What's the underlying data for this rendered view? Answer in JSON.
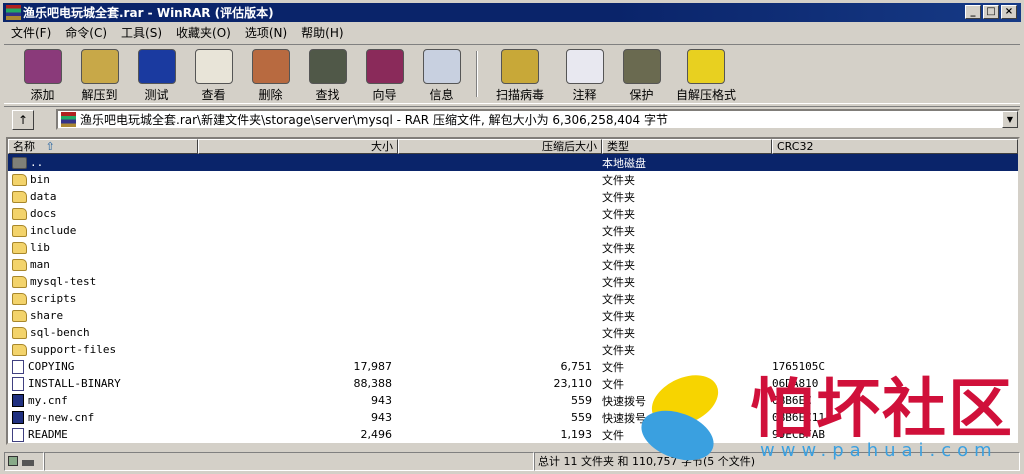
{
  "window": {
    "title": "渔乐吧电玩城全套.rar - WinRAR (评估版本)",
    "minimize": "_",
    "maximize": "□",
    "close": "×"
  },
  "menu": [
    "文件(F)",
    "命令(C)",
    "工具(S)",
    "收藏夹(O)",
    "选项(N)",
    "帮助(H)"
  ],
  "toolbar": [
    {
      "label": "添加",
      "icon": "add-archive-icon",
      "color": "#8a3a7a"
    },
    {
      "label": "解压到",
      "icon": "extract-to-icon",
      "color": "#c8a848"
    },
    {
      "label": "测试",
      "icon": "test-icon",
      "color": "#1a3aa0"
    },
    {
      "label": "查看",
      "icon": "view-icon",
      "color": "#e8e4d8"
    },
    {
      "label": "删除",
      "icon": "delete-icon",
      "color": "#b86a40"
    },
    {
      "label": "查找",
      "icon": "find-icon",
      "color": "#505848"
    },
    {
      "label": "向导",
      "icon": "wizard-icon",
      "color": "#8a2a5a"
    },
    {
      "label": "信息",
      "icon": "info-icon",
      "color": "#c8d0e0"
    },
    {
      "label": "扫描病毒",
      "icon": "scan-virus-icon",
      "color": "#c8a838"
    },
    {
      "label": "注释",
      "icon": "comment-icon",
      "color": "#e8e8f0"
    },
    {
      "label": "保护",
      "icon": "protect-icon",
      "color": "#6a6a50"
    },
    {
      "label": "自解压格式",
      "icon": "sfx-icon",
      "color": "#e8d020"
    }
  ],
  "address": {
    "up": "↑",
    "path": "渔乐吧电玩城全套.rar\\新建文件夹\\storage\\server\\mysql - RAR 压缩文件, 解包大小为 6,306,258,404 字节",
    "dropdown": "▼"
  },
  "columns": {
    "name": "名称",
    "sort": "⇧",
    "size": "大小",
    "packed": "压缩后大小",
    "type": "类型",
    "crc": "CRC32"
  },
  "rows": [
    {
      "name": "..",
      "size": "",
      "packed": "",
      "type": "本地磁盘",
      "crc": "",
      "kind": "up"
    },
    {
      "name": "bin",
      "size": "",
      "packed": "",
      "type": "文件夹",
      "crc": "",
      "kind": "folder"
    },
    {
      "name": "data",
      "size": "",
      "packed": "",
      "type": "文件夹",
      "crc": "",
      "kind": "folder"
    },
    {
      "name": "docs",
      "size": "",
      "packed": "",
      "type": "文件夹",
      "crc": "",
      "kind": "folder"
    },
    {
      "name": "include",
      "size": "",
      "packed": "",
      "type": "文件夹",
      "crc": "",
      "kind": "folder"
    },
    {
      "name": "lib",
      "size": "",
      "packed": "",
      "type": "文件夹",
      "crc": "",
      "kind": "folder"
    },
    {
      "name": "man",
      "size": "",
      "packed": "",
      "type": "文件夹",
      "crc": "",
      "kind": "folder"
    },
    {
      "name": "mysql-test",
      "size": "",
      "packed": "",
      "type": "文件夹",
      "crc": "",
      "kind": "folder"
    },
    {
      "name": "scripts",
      "size": "",
      "packed": "",
      "type": "文件夹",
      "crc": "",
      "kind": "folder"
    },
    {
      "name": "share",
      "size": "",
      "packed": "",
      "type": "文件夹",
      "crc": "",
      "kind": "folder"
    },
    {
      "name": "sql-bench",
      "size": "",
      "packed": "",
      "type": "文件夹",
      "crc": "",
      "kind": "folder"
    },
    {
      "name": "support-files",
      "size": "",
      "packed": "",
      "type": "文件夹",
      "crc": "",
      "kind": "folder"
    },
    {
      "name": "COPYING",
      "size": "17,987",
      "packed": "6,751",
      "type": "文件",
      "crc": "1765105C",
      "kind": "file"
    },
    {
      "name": "INSTALL-BINARY",
      "size": "88,388",
      "packed": "23,110",
      "type": "文件",
      "crc": "06DA810",
      "kind": "file"
    },
    {
      "name": "my.cnf",
      "size": "943",
      "packed": "559",
      "type": "快速拨号",
      "crc": "0BB6EC",
      "kind": "lnk"
    },
    {
      "name": "my-new.cnf",
      "size": "943",
      "packed": "559",
      "type": "快速拨号",
      "crc": "0BB6EC11",
      "kind": "lnk"
    },
    {
      "name": "README",
      "size": "2,496",
      "packed": "1,193",
      "type": "文件",
      "crc": "99ECBFAB",
      "kind": "file"
    }
  ],
  "status": {
    "summary": "总计 11 文件夹 和 110,757 字节(5 个文件)"
  },
  "watermark": {
    "title": "怕坏社区",
    "url": "www.pahuai.com"
  }
}
